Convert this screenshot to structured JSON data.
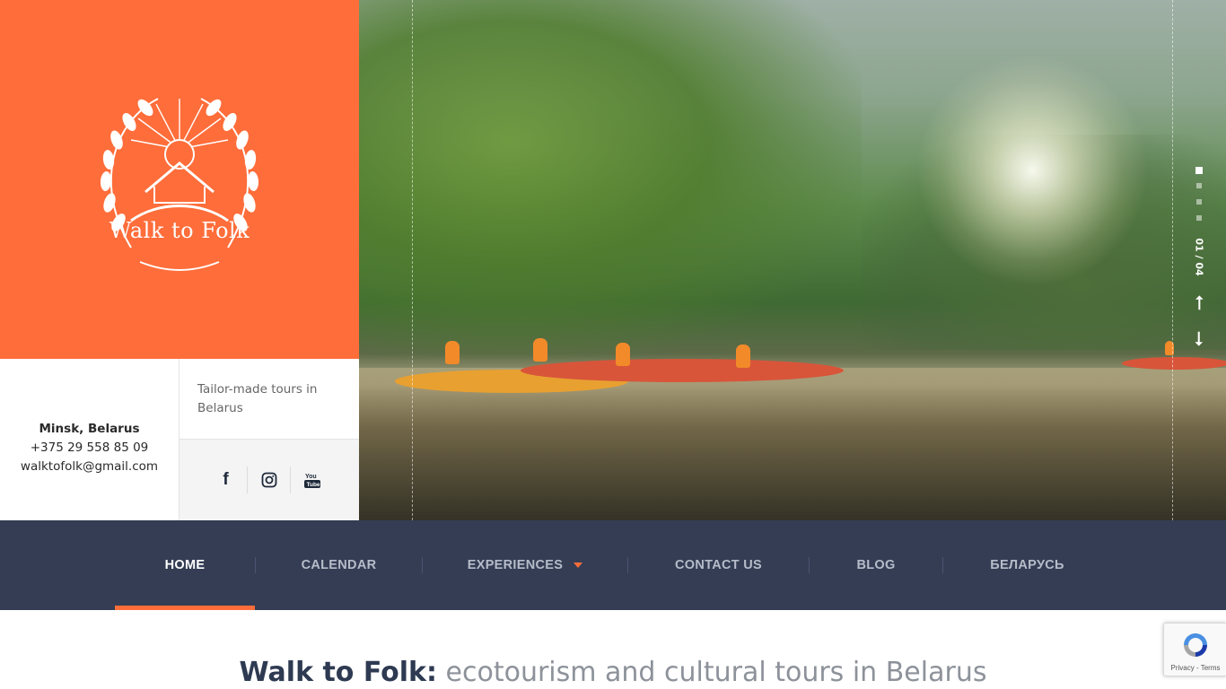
{
  "brand": {
    "name": "Walk to Folk",
    "accent_color": "#ff6d3a",
    "nav_bg_color": "#343d54"
  },
  "contact": {
    "city": "Minsk, Belarus",
    "phone": "+375 29 558 85 09",
    "email": "walktofolk@gmail.com"
  },
  "tagline": "Tailor-made tours in Belarus",
  "social": [
    {
      "name": "facebook-icon",
      "glyph": "f"
    },
    {
      "name": "instagram-icon",
      "glyph": "◎"
    },
    {
      "name": "youtube-icon",
      "glyph": "▶"
    }
  ],
  "hero": {
    "counter": "01 / 04",
    "arrow_up": "⭡",
    "arrow_down": "⭣"
  },
  "nav": {
    "items": [
      {
        "label": "HOME",
        "active": true
      },
      {
        "label": "CALENDAR"
      },
      {
        "label": "EXPERIENCES",
        "has_dropdown": true
      },
      {
        "label": "CONTACT US"
      },
      {
        "label": "BLOG"
      },
      {
        "label": "БЕЛАРУСЬ"
      }
    ]
  },
  "headline": {
    "strong": "Walk to Folk:",
    "light": "ecotourism and cultural tours in Belarus"
  },
  "recaptcha": {
    "links": "Privacy - Terms"
  }
}
